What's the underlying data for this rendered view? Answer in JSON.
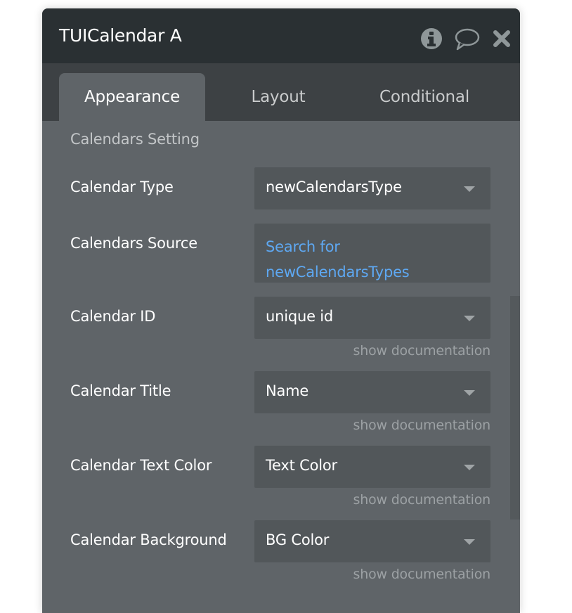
{
  "window": {
    "title": "TUICalendar A",
    "icons": [
      "info-icon",
      "comment-icon",
      "close-icon"
    ]
  },
  "tabs": [
    {
      "label": "Appearance",
      "active": true
    },
    {
      "label": "Layout",
      "active": false
    },
    {
      "label": "Conditional",
      "active": false
    }
  ],
  "section": {
    "title": "Calendars Setting"
  },
  "fields": [
    {
      "label": "Calendar Type",
      "value": "newCalendarsType",
      "type": "dropdown"
    },
    {
      "label": "Calendars Source",
      "value": "Search for newCalendarsTypes",
      "type": "search"
    },
    {
      "label": "Calendar ID",
      "value": "unique id",
      "type": "dropdown",
      "doc": "show documentation"
    },
    {
      "label": "Calendar Title",
      "value": "Name",
      "type": "dropdown",
      "doc": "show documentation"
    },
    {
      "label": "Calendar Text Color",
      "value": "Text Color",
      "type": "dropdown",
      "doc": "show documentation"
    },
    {
      "label": "Calendar Background",
      "value": "BG Color",
      "type": "dropdown",
      "doc": "show documentation"
    }
  ],
  "colors": {
    "header_bg": "#2a3033",
    "tabs_bg": "#3d4144",
    "panel_bg": "#5f6468",
    "field_bg": "#52575a",
    "link_blue": "#5ea8f2"
  }
}
